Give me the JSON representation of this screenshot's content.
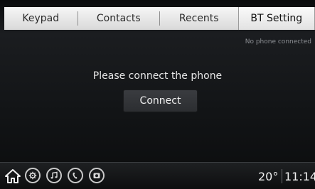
{
  "tabs": [
    {
      "label": "Keypad",
      "active": false
    },
    {
      "label": "Contacts",
      "active": false
    },
    {
      "label": "Recents",
      "active": false
    },
    {
      "label": "BT Setting",
      "active": true
    }
  ],
  "status_text": "No phone connected",
  "message": "Please connect the phone",
  "connect_label": "Connect",
  "bottom_bar": {
    "icons": [
      "home-icon",
      "settings-icon",
      "music-icon",
      "phone-icon",
      "camera-icon"
    ],
    "temperature": "20°",
    "time": "11:14"
  },
  "colors": {
    "background": "#121416",
    "tab_bar": "#e6e6e6",
    "button": "#333539",
    "text": "#e8e8e8",
    "status_text": "#8c8f93"
  }
}
